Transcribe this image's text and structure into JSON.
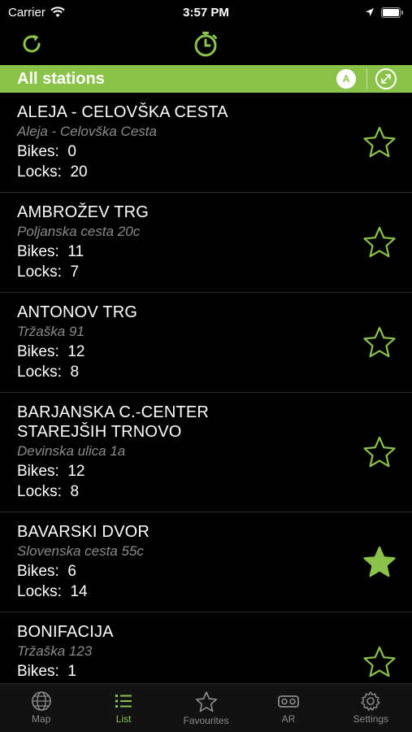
{
  "status_bar": {
    "carrier": "Carrier",
    "time": "3:57 PM"
  },
  "colors": {
    "accent": "#8bc34a",
    "background": "#000000",
    "secondary_text": "#8a8a8a"
  },
  "toolbar": {
    "refresh_icon": "refresh-icon",
    "timer_icon": "timer-icon"
  },
  "header": {
    "title": "All stations",
    "sort_badge": "A"
  },
  "stations": [
    {
      "name": "ALEJA - CELOVŠKA CESTA",
      "address": "Aleja - Celovška Cesta",
      "bikes": "0",
      "locks": "20",
      "favourite": false
    },
    {
      "name": "AMBROŽEV TRG",
      "address": "Poljanska cesta 20c",
      "bikes": "11",
      "locks": "7",
      "favourite": false
    },
    {
      "name": "ANTONOV TRG",
      "address": "Tržaška 91",
      "bikes": "12",
      "locks": "8",
      "favourite": false
    },
    {
      "name": "BARJANSKA C.-CENTER STAREJŠIH TRNOVO",
      "address": "Devinska ulica 1a",
      "bikes": "12",
      "locks": "8",
      "favourite": false
    },
    {
      "name": "BAVARSKI DVOR",
      "address": "Slovenska cesta 55c",
      "bikes": "6",
      "locks": "14",
      "favourite": true
    },
    {
      "name": "BONIFACIJA",
      "address": "Tržaška 123",
      "bikes": "1",
      "locks": "",
      "favourite": false
    }
  ],
  "labels": {
    "bikes": "Bikes:",
    "locks": "Locks:"
  },
  "tabs": [
    {
      "label": "Map",
      "icon": "globe-icon",
      "active": false
    },
    {
      "label": "List",
      "icon": "list-icon",
      "active": true
    },
    {
      "label": "Favourites",
      "icon": "star-icon",
      "active": false
    },
    {
      "label": "AR",
      "icon": "vr-headset-icon",
      "active": false
    },
    {
      "label": "Settings",
      "icon": "gear-icon",
      "active": false
    }
  ]
}
